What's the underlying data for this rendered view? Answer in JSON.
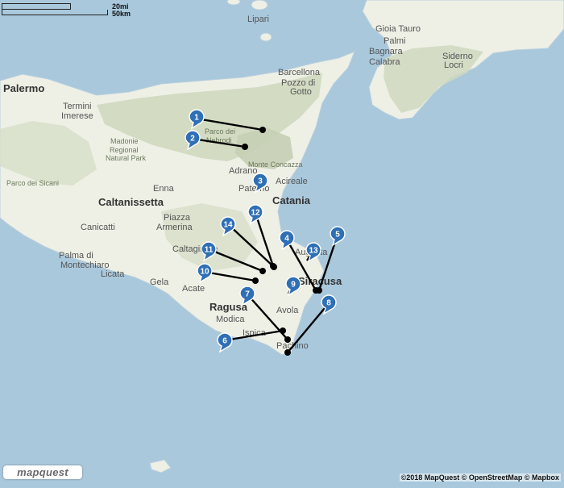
{
  "scale": {
    "miles_label": "20mi",
    "km_label": "50km"
  },
  "places": [
    {
      "text": "Lipari",
      "style": "normal"
    },
    {
      "text": "Gioia Tauro",
      "style": "normal"
    },
    {
      "text": "Palmi",
      "style": "normal"
    },
    {
      "text": "Bagnara",
      "style": "normal"
    },
    {
      "text": "Calabra",
      "style": "normal"
    },
    {
      "text": "Siderno",
      "style": "normal"
    },
    {
      "text": "Locri",
      "style": "normal"
    },
    {
      "text": "Palermo",
      "style": "big"
    },
    {
      "text": "Barcellona",
      "style": "normal"
    },
    {
      "text": "Pozzo di",
      "style": "normal"
    },
    {
      "text": "Gotto",
      "style": "normal"
    },
    {
      "text": "Termini",
      "style": "normal"
    },
    {
      "text": "Imerese",
      "style": "normal"
    },
    {
      "text": "Parco dei",
      "style": "park"
    },
    {
      "text": "Nebrodi",
      "style": "park"
    },
    {
      "text": "Madonie",
      "style": "park"
    },
    {
      "text": "Regional",
      "style": "park"
    },
    {
      "text": "Natural Park",
      "style": "park"
    },
    {
      "text": "Adrano",
      "style": "normal"
    },
    {
      "text": "Monte Concazza",
      "style": "park"
    },
    {
      "text": "Acireale",
      "style": "normal"
    },
    {
      "text": "Parco dei Sicani",
      "style": "park"
    },
    {
      "text": "Enna",
      "style": "normal"
    },
    {
      "text": "Paterno",
      "style": "normal"
    },
    {
      "text": "Caltanissetta",
      "style": "big"
    },
    {
      "text": "Catania",
      "style": "big"
    },
    {
      "text": "Canicatti",
      "style": "normal"
    },
    {
      "text": "Piazza",
      "style": "normal"
    },
    {
      "text": "Armerina",
      "style": "normal"
    },
    {
      "text": "Augusta",
      "style": "normal"
    },
    {
      "text": "Caltagirone",
      "style": "normal"
    },
    {
      "text": "Palma di",
      "style": "normal"
    },
    {
      "text": "Montechiaro",
      "style": "normal"
    },
    {
      "text": "Licata",
      "style": "normal"
    },
    {
      "text": "Siracusa",
      "style": "big"
    },
    {
      "text": "Gela",
      "style": "normal"
    },
    {
      "text": "Acate",
      "style": "normal"
    },
    {
      "text": "Ragusa",
      "style": "big"
    },
    {
      "text": "Avola",
      "style": "normal"
    },
    {
      "text": "Modica",
      "style": "normal"
    },
    {
      "text": "Ispica",
      "style": "normal"
    },
    {
      "text": "Pachino",
      "style": "normal"
    }
  ],
  "markers": [
    {
      "label": "1"
    },
    {
      "label": "2"
    },
    {
      "label": "3"
    },
    {
      "label": "4"
    },
    {
      "label": "5"
    },
    {
      "label": "6"
    },
    {
      "label": "7"
    },
    {
      "label": "8"
    },
    {
      "label": "9"
    },
    {
      "label": "10"
    },
    {
      "label": "11"
    },
    {
      "label": "12"
    },
    {
      "label": "13"
    },
    {
      "label": "14"
    }
  ],
  "logo": {
    "text": "mapquest"
  },
  "attribution": {
    "text": "©2018 MapQuest © OpenStreetMap © Mapbox"
  },
  "colors": {
    "sea": "#a9c8dc",
    "land": "#eef0e6",
    "hills": "#cfd8bf",
    "marker": "#2f6fb5",
    "route": "#000000"
  }
}
